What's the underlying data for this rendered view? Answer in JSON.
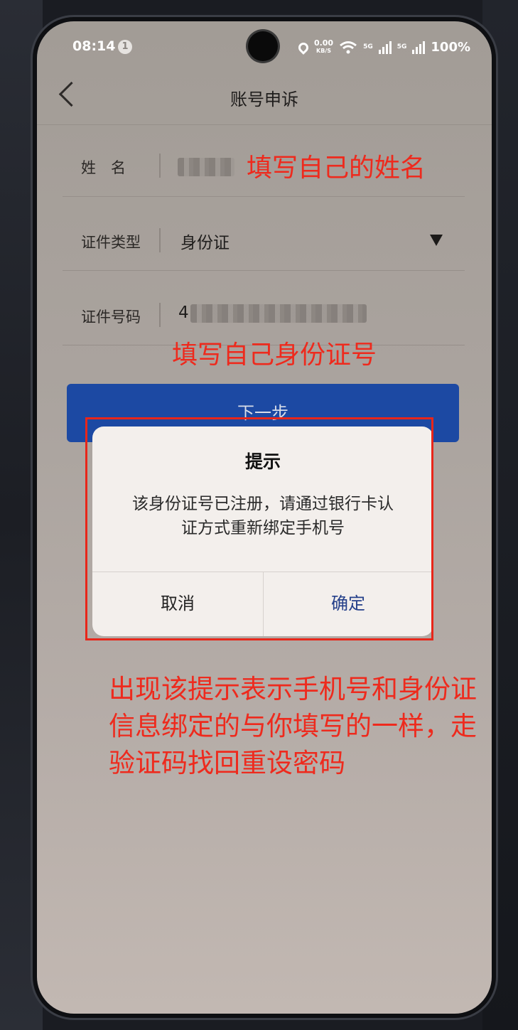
{
  "status_bar": {
    "time": "08:14",
    "notification_count": "1",
    "net_speed_top": "0.00",
    "net_speed_unit": "KB/S",
    "sim1": "5G",
    "sim2": "5G",
    "battery": "100%"
  },
  "page": {
    "title": "账号申诉"
  },
  "form": {
    "name_label": "姓　名",
    "id_type_label": "证件类型",
    "id_type_value": "身份证",
    "id_number_label": "证件号码",
    "id_number_prefix": "4"
  },
  "next_button": "下一步",
  "dialog": {
    "title": "提示",
    "message": "该身份证号已注册，请通过银行卡认证方式重新绑定手机号",
    "cancel": "取消",
    "ok": "确定"
  },
  "annotations": {
    "name_hint": "填写自己的姓名",
    "id_hint": "填写自己身份证号",
    "explain_line1": "出现该提示表示手机号和身份证",
    "explain_line2": "信息绑定的与你填写的一样，走",
    "explain_line3": "验证码找回重设密码"
  },
  "colors": {
    "annotation_red": "#ee2a1d",
    "primary_blue": "#1c49a3"
  }
}
